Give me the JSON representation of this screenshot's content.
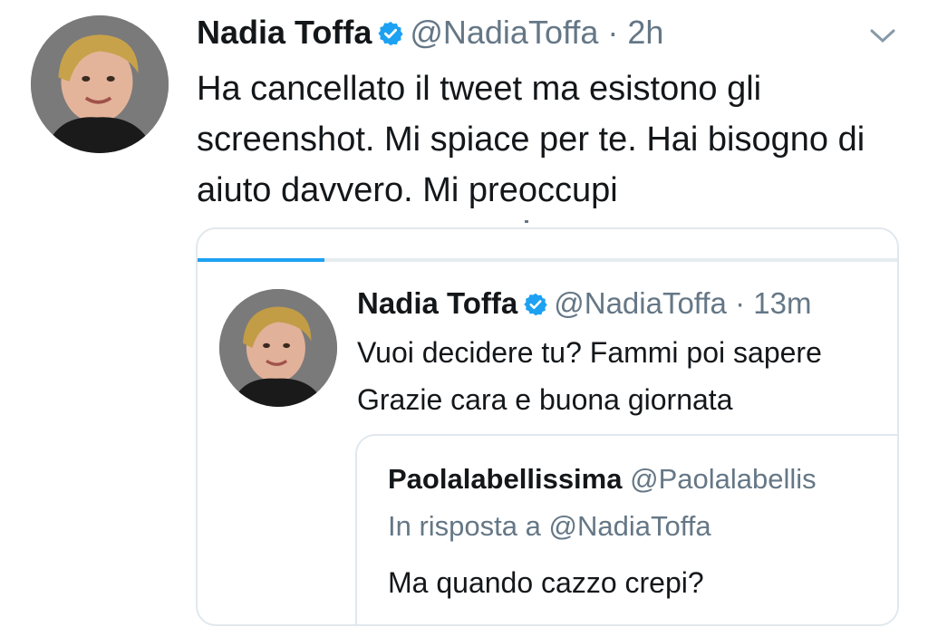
{
  "tweet": {
    "author_name": "Nadia Toffa",
    "author_handle": "@NadiaToffa",
    "separator": "·",
    "time": "2h",
    "text": "Ha cancellato il tweet ma esistono gli screenshot. Mi spiace per te. Hai bisogno di aiuto davvero. Mi preoccupi",
    "menu_icon": "chevron-down-icon"
  },
  "quoted": {
    "author_name": "Nadia Toffa",
    "author_handle": "@NadiaToffa",
    "separator": "·",
    "time": "13m",
    "text_line1": "Vuoi decidere tu? Fammi poi sapere",
    "text_line2": "Grazie cara e buona giornata",
    "inner": {
      "author_name": "Paolalabellissima",
      "author_handle": "@Paolalabellis",
      "reply_prefix": "In risposta a",
      "reply_to": "@NadiaToffa",
      "text": "Ma quando cazzo crepi?"
    }
  },
  "colors": {
    "verified": "#1da1f2",
    "handle": "#657786",
    "accent": "#1da1f2",
    "border": "#e1e8ed"
  }
}
